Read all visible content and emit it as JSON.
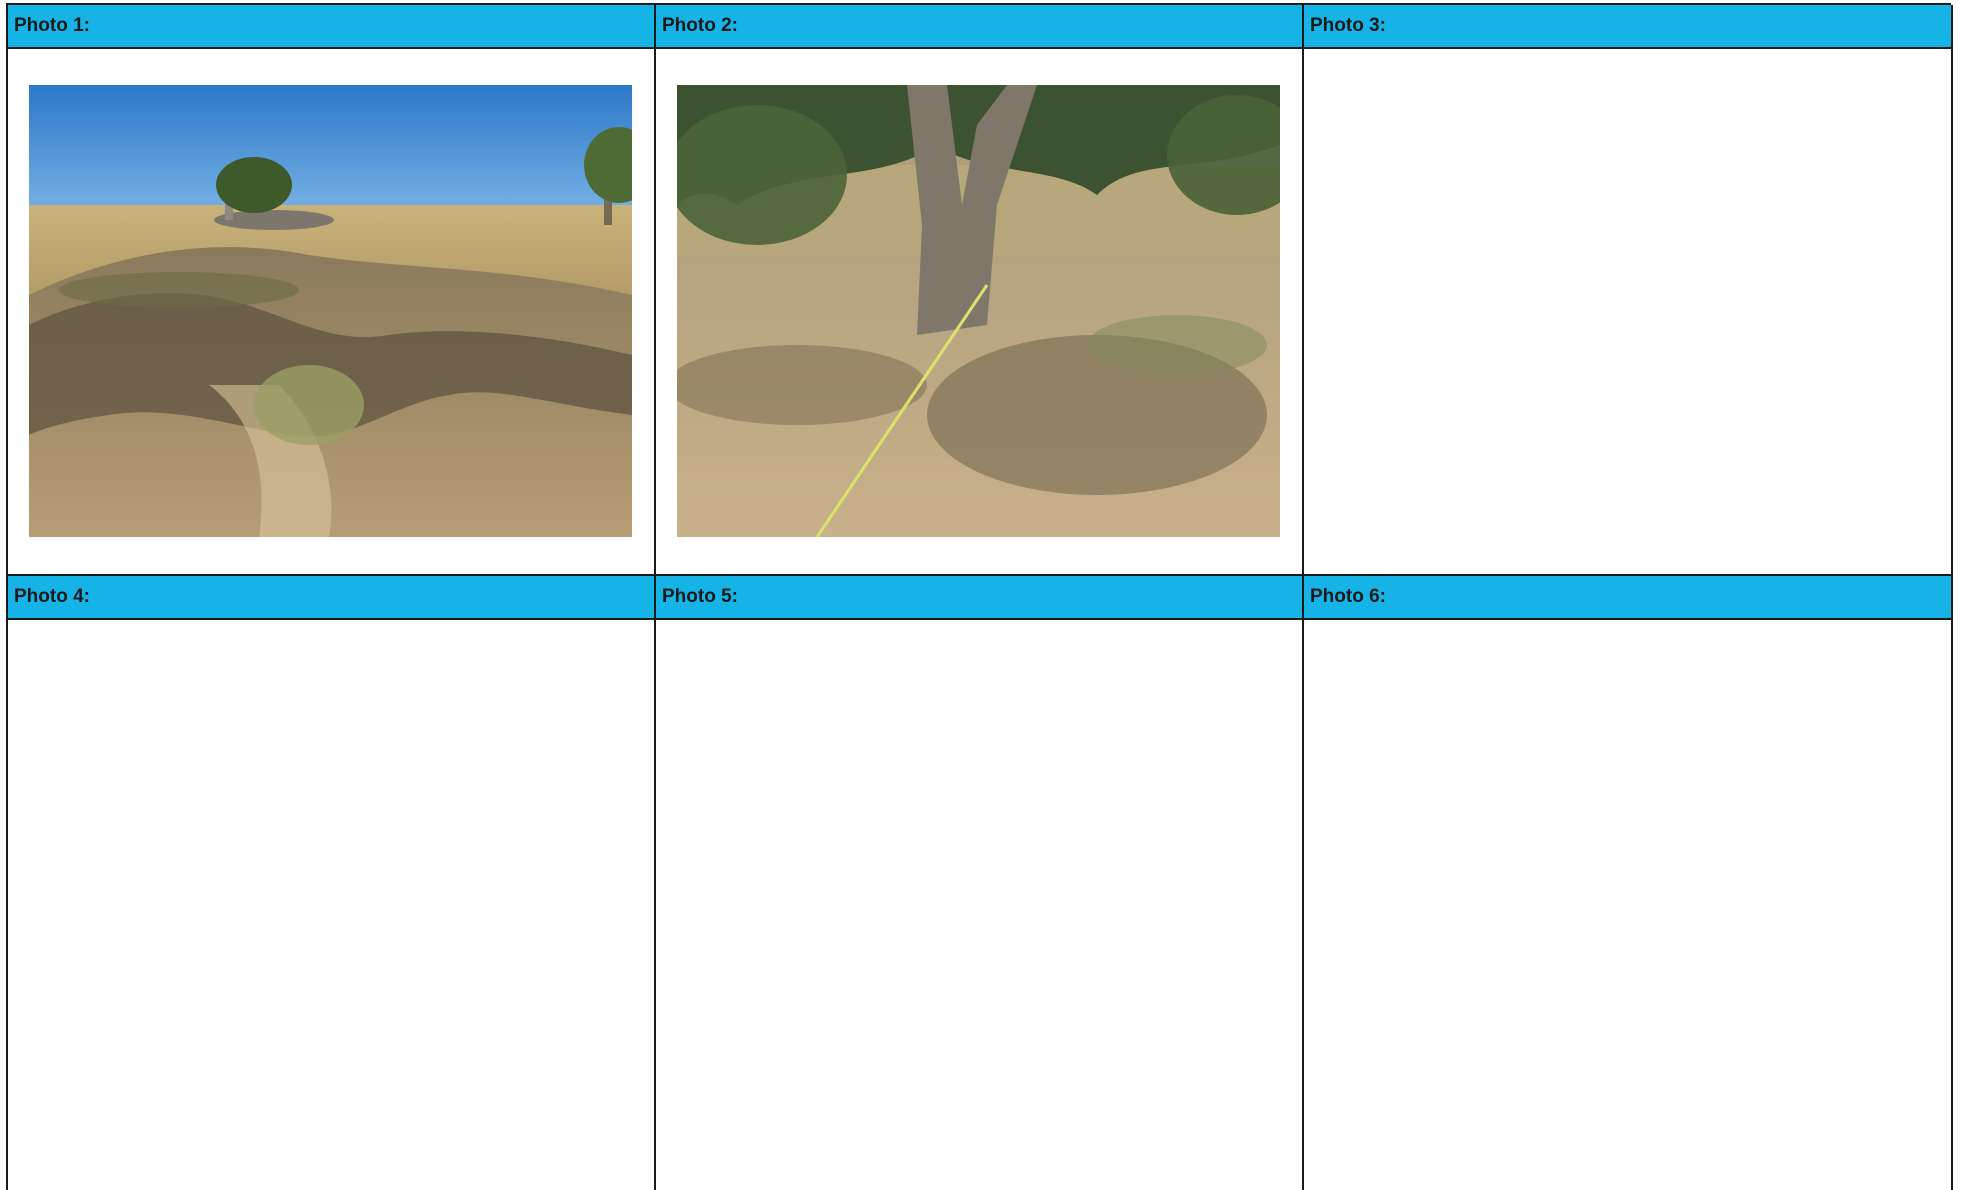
{
  "sheet": {
    "headers": [
      "Photo 1:",
      "Photo 2:",
      "Photo 3:",
      "Photo 4:",
      "Photo 5:",
      "Photo 6:"
    ],
    "photos": [
      {
        "label": "Photo 1:",
        "present": true,
        "description": "open grassland with scattered trees, shaded bare ground in foreground"
      },
      {
        "label": "Photo 2:",
        "present": true,
        "description": "large eucalypt trunk with measuring tape stretched across dappled dirt"
      },
      {
        "label": "Photo 3:",
        "present": false
      },
      {
        "label": "Photo 4:",
        "present": false
      },
      {
        "label": "Photo 5:",
        "present": false
      },
      {
        "label": "Photo 6:",
        "present": false
      }
    ],
    "colors": {
      "header_bg": "#16b4e6",
      "grid_line": "#1a1a1a",
      "header_text": "#1a1a1a"
    }
  }
}
